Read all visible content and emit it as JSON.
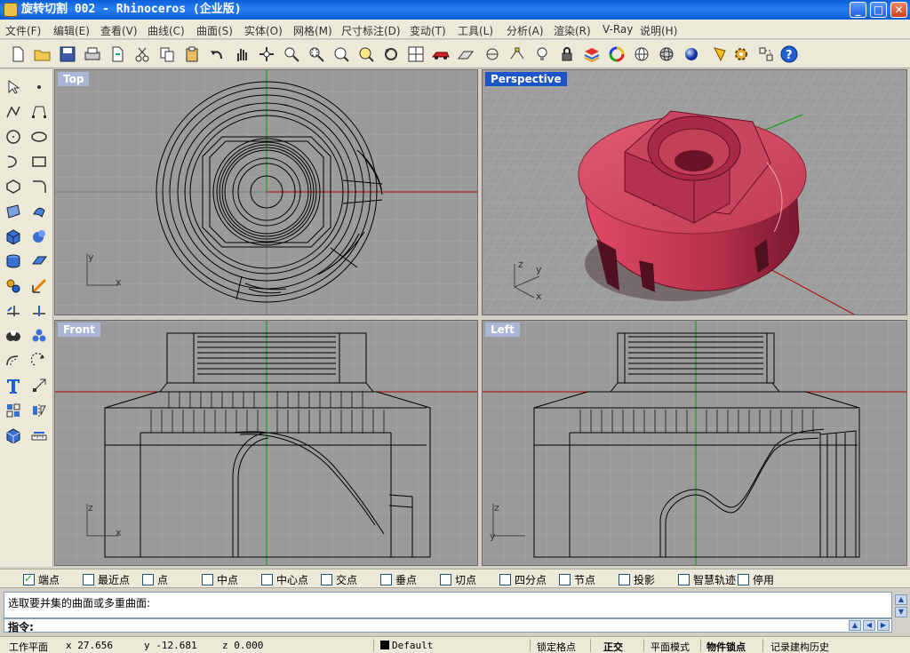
{
  "window": {
    "title": "旋转切割 002 - Rhinoceros (企业版)",
    "min_label": "_",
    "max_label": "□",
    "close_label": "✕"
  },
  "menu": [
    "文件(F)",
    "编辑(E)",
    "查看(V)",
    "曲线(C)",
    "曲面(S)",
    "实体(O)",
    "网格(M)",
    "尺寸标注(D)",
    "变动(T)",
    "工具(L)",
    "分析(A)",
    "渲染(R)",
    "V-Ray",
    "说明(H)"
  ],
  "viewports": {
    "top": {
      "label": "Top",
      "axis_a": "y",
      "axis_b": "x"
    },
    "perspective": {
      "label": "Perspective",
      "axis_a": "z",
      "axis_b": "y",
      "axis_c": "x"
    },
    "front": {
      "label": "Front",
      "axis_a": "z",
      "axis_b": "x"
    },
    "left": {
      "label": "Left",
      "axis_a": "z",
      "axis_b": "y"
    }
  },
  "osnap": [
    {
      "label": "端点",
      "checked": true
    },
    {
      "label": "最近点",
      "checked": false
    },
    {
      "label": "点",
      "checked": false
    },
    {
      "label": "中点",
      "checked": false
    },
    {
      "label": "中心点",
      "checked": false
    },
    {
      "label": "交点",
      "checked": false
    },
    {
      "label": "垂点",
      "checked": false
    },
    {
      "label": "切点",
      "checked": false
    },
    {
      "label": "四分点",
      "checked": false
    },
    {
      "label": "节点",
      "checked": false
    },
    {
      "label": "投影",
      "checked": false
    },
    {
      "label": "智慧轨迹",
      "checked": false
    },
    {
      "label": "停用",
      "checked": false
    }
  ],
  "command": {
    "history_line": "选取要并集的曲面或多重曲面:",
    "prompt": "指令:"
  },
  "status": {
    "cplane": "工作平面",
    "x": "x 27.656",
    "y": "y -12.681",
    "z": "z 0.000",
    "layer": "Default",
    "grid_snap": "锁定格点",
    "ortho": "正交",
    "planar": "平面模式",
    "osnap": "物件锁点",
    "history": "记录建构历史"
  },
  "colors": {
    "model": "#c8405a",
    "viewport_bg": "#9a9a9a",
    "active_label": "#1c55c8"
  }
}
